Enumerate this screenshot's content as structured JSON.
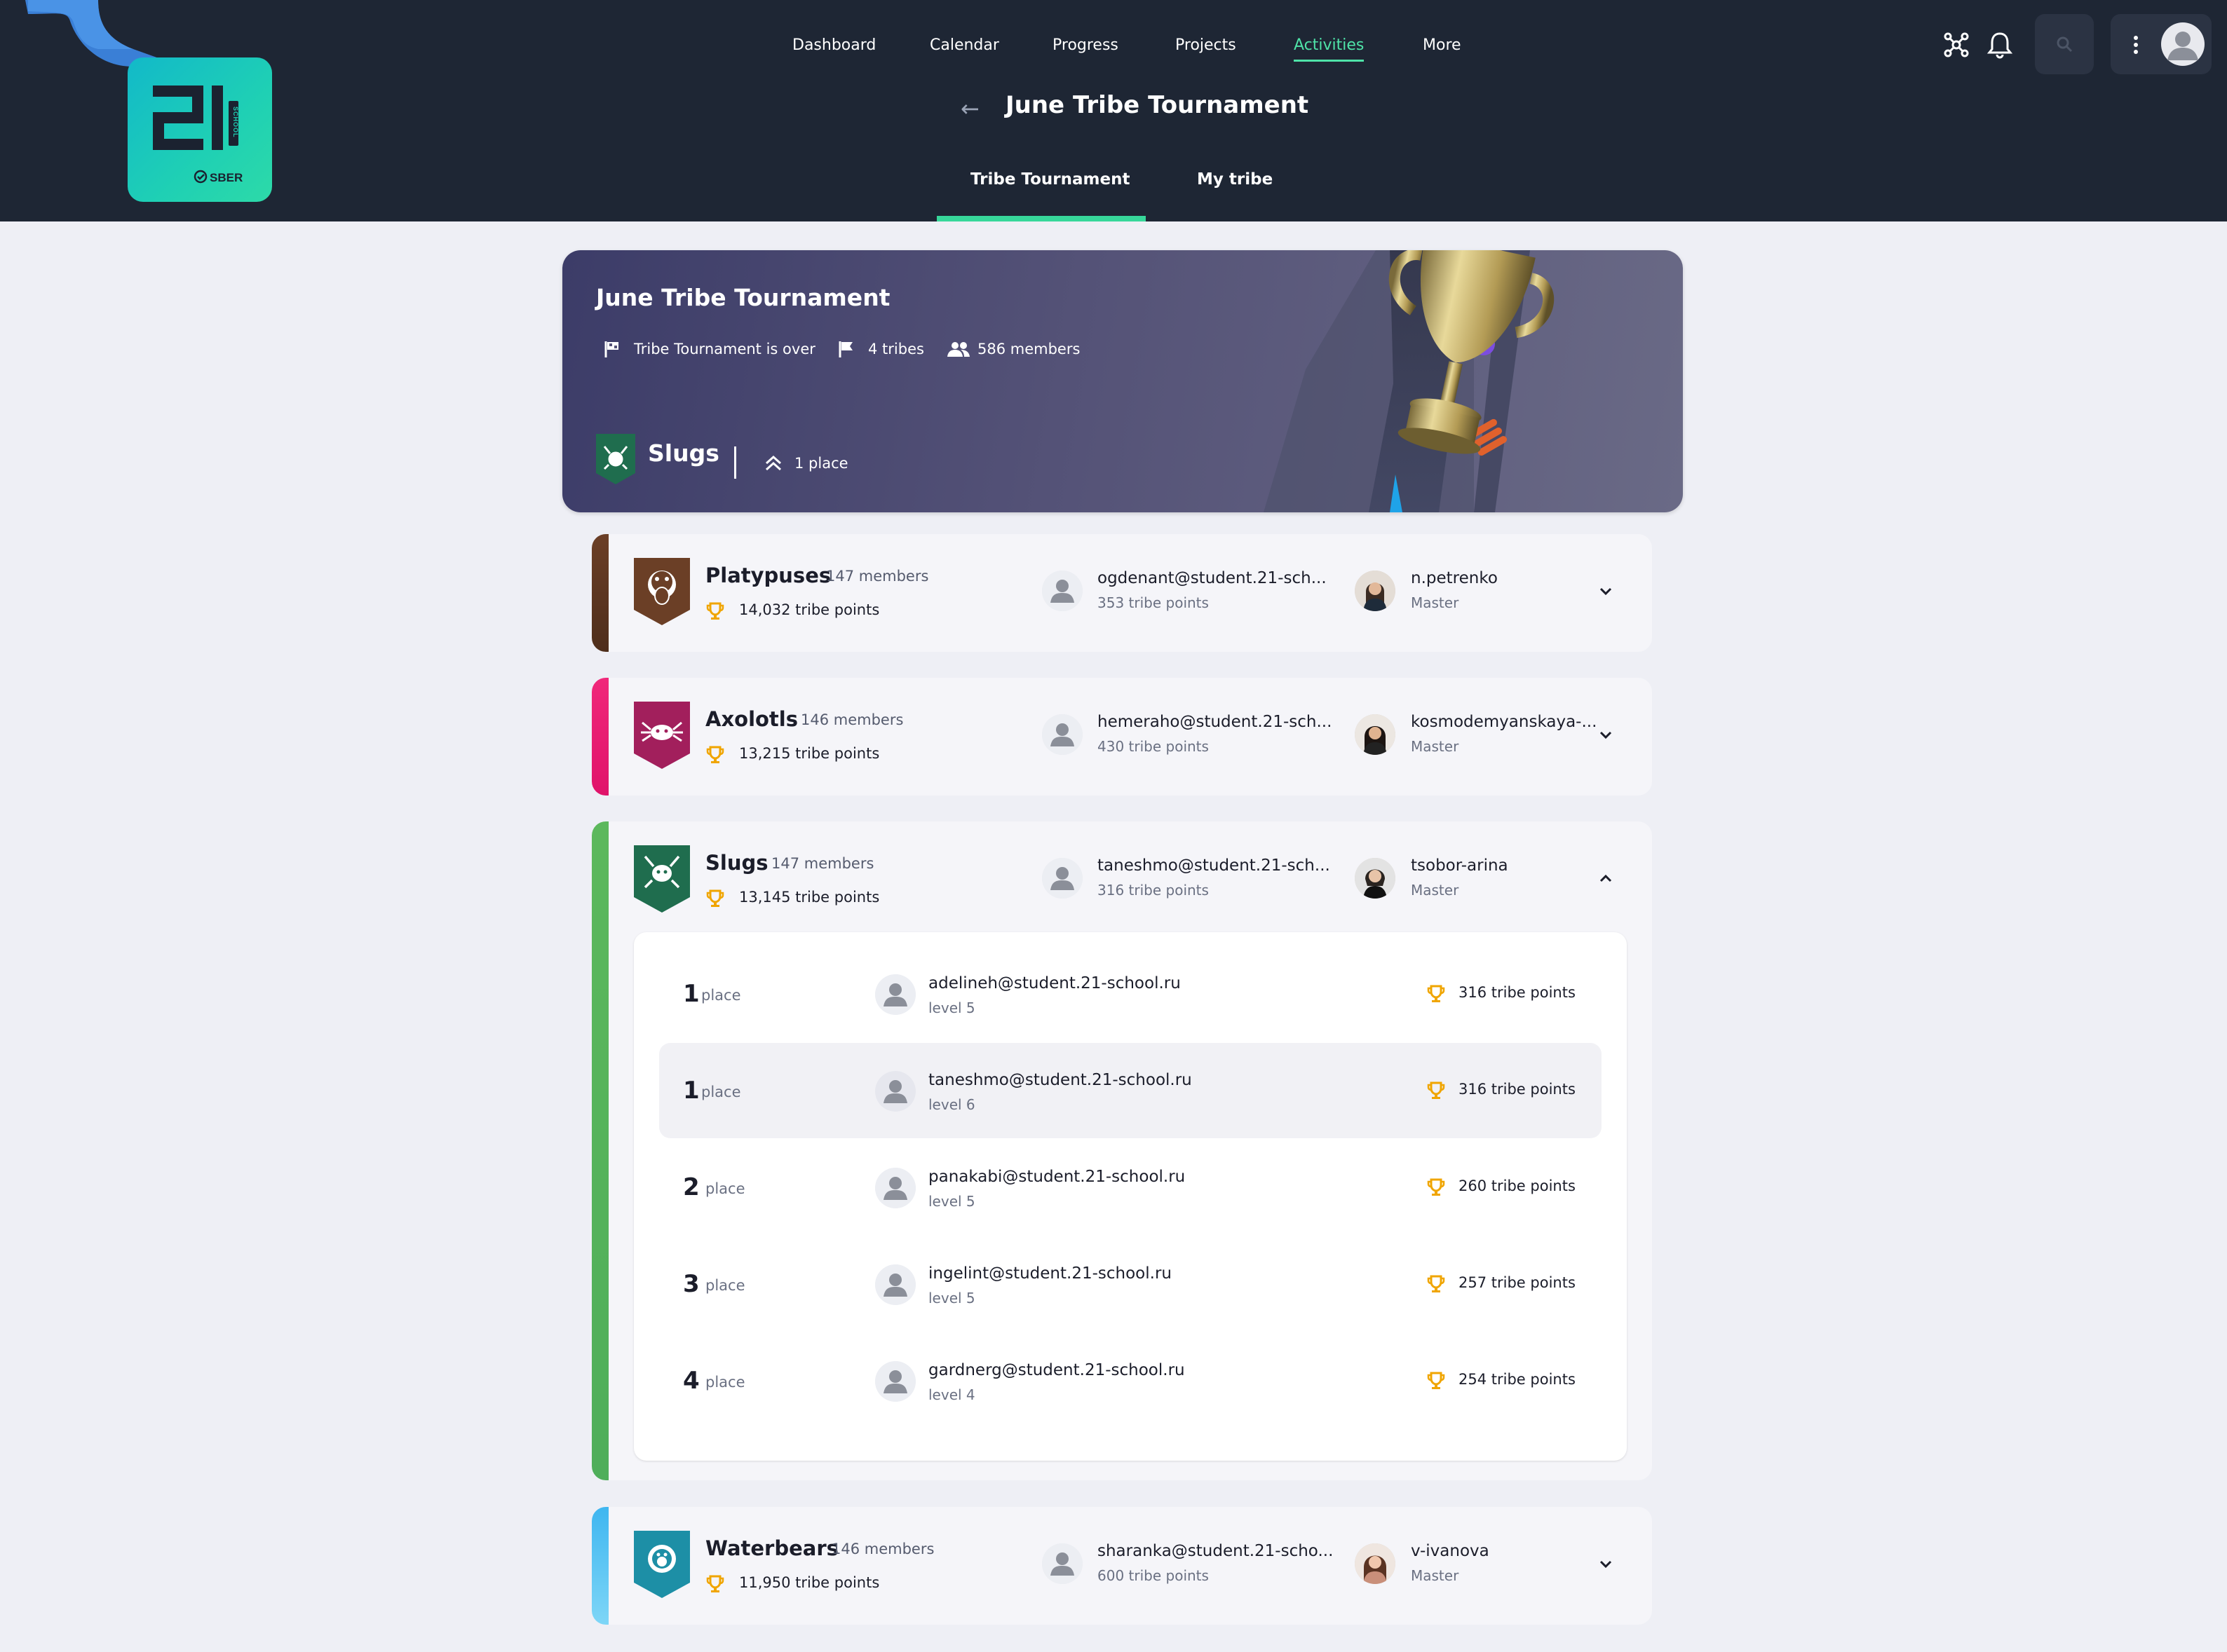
{
  "nav": {
    "items": [
      "Dashboard",
      "Calendar",
      "Progress",
      "Projects",
      "Activities",
      "More"
    ],
    "active": "Activities"
  },
  "page": {
    "title": "June Tribe Tournament",
    "tabs": [
      "Tribe Tournament",
      "My tribe"
    ],
    "active_tab": "Tribe Tournament"
  },
  "logo": {
    "brand": "21",
    "school": "SCHOOL",
    "partner": "SBER"
  },
  "hero": {
    "title": "June Tribe Tournament",
    "status": "Tribe Tournament is over",
    "tribes": "4 tribes",
    "members": "586 members",
    "my_tribe": "Slugs",
    "my_place": "1 place"
  },
  "tribes": [
    {
      "name": "Platypuses",
      "members": "147 members",
      "points": "14,032 tribe points",
      "color": "#6b3f26",
      "icon": "platypus-icon",
      "top_student": {
        "login": "ogdenant@student.21-sch...",
        "points": "353 tribe points"
      },
      "master": {
        "login": "n.petrenko",
        "role": "Master"
      },
      "expanded": false
    },
    {
      "name": "Axolotls",
      "members": "146 members",
      "points": "13,215 tribe points",
      "color": "#a21f5c",
      "icon": "axolotl-icon",
      "top_student": {
        "login": "hemeraho@student.21-sch...",
        "points": "430 tribe points"
      },
      "master": {
        "login": "kosmodemyanskaya-...",
        "role": "Master"
      },
      "expanded": false
    },
    {
      "name": "Slugs",
      "members": "147 members",
      "points": "13,145 tribe points",
      "color": "#1f6d4e",
      "icon": "slug-icon",
      "top_student": {
        "login": "taneshmo@student.21-sch...",
        "points": "316 tribe points"
      },
      "master": {
        "login": "tsobor-arina",
        "role": "Master"
      },
      "expanded": true,
      "ranking": [
        {
          "place": "1",
          "place_label": "place",
          "login": "adelineh@student.21-school.ru",
          "level": "level 5",
          "points": "316 tribe points"
        },
        {
          "place": "1",
          "place_label": "place",
          "login": "taneshmo@student.21-school.ru",
          "level": "level 6",
          "points": "316 tribe points"
        },
        {
          "place": "2",
          "place_label": "place",
          "login": "panakabi@student.21-school.ru",
          "level": "level 5",
          "points": "260 tribe points"
        },
        {
          "place": "3",
          "place_label": "place",
          "login": "ingelint@student.21-school.ru",
          "level": "level 5",
          "points": "257 tribe points"
        },
        {
          "place": "4",
          "place_label": "place",
          "login": "gardnerg@student.21-school.ru",
          "level": "level 4",
          "points": "254 tribe points"
        }
      ]
    },
    {
      "name": "Waterbears",
      "members": "146 members",
      "points": "11,950 tribe points",
      "color": "#1d8fa6",
      "icon": "waterbear-icon",
      "top_student": {
        "login": "sharanka@student.21-scho...",
        "points": "600 tribe points"
      },
      "master": {
        "login": "v-ivanova",
        "role": "Master"
      },
      "expanded": false
    }
  ],
  "colors": {
    "header_bg": "#1e2634",
    "accent_green": "#37d79a",
    "page_bg": "#eeeff5",
    "trophy": "#f0a500",
    "stripe_platypuses": "#6b3f26",
    "stripe_axolotls": "#f0287a",
    "stripe_slugs": "#5cb85c",
    "stripe_waterbears": "#5ac8f0"
  }
}
